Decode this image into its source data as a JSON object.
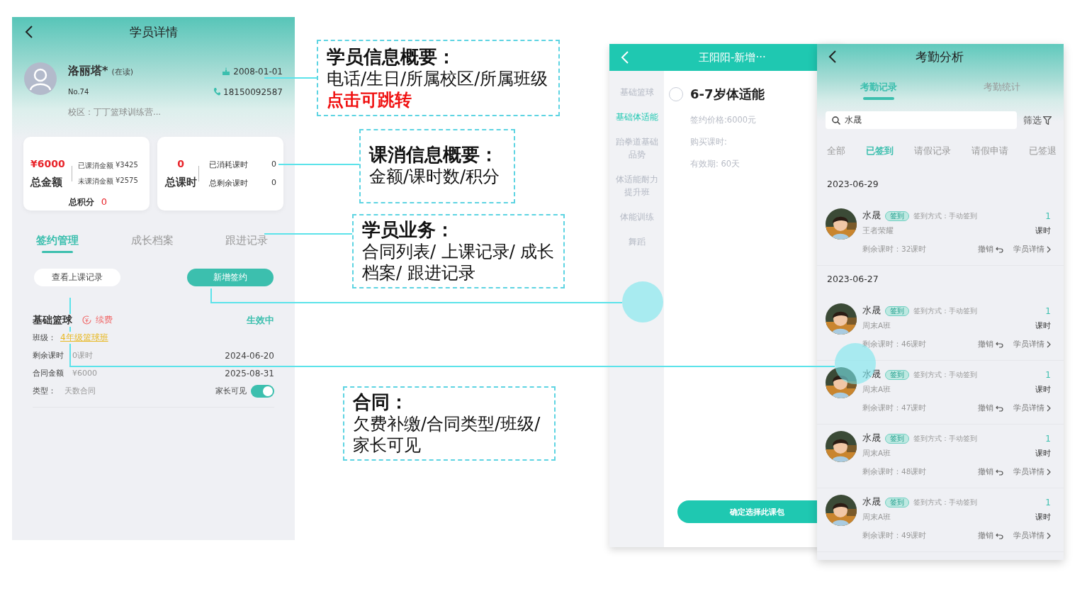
{
  "student": {
    "title": "学员详情",
    "name": "洛丽塔*",
    "status": "(在读)",
    "number": "No.74",
    "birthday": "2008-01-01",
    "phone": "18150092587",
    "campus": "校区：丁丁篮球训练营...",
    "amount_card": {
      "total": "¥6000",
      "total_label": "总金额",
      "consumed_label": "已课消金额",
      "consumed": "¥3425",
      "unconsumed_label": "未课消金额",
      "unconsumed": "¥2575",
      "points_label": "总积分",
      "points": "0"
    },
    "hours_card": {
      "total": "0",
      "total_label": "总课时",
      "used_label": "已消耗课时",
      "used": "0",
      "remaining_label": "总剩余课时",
      "remaining": "0"
    },
    "tabs": [
      {
        "label": "签约管理",
        "selected": true
      },
      {
        "label": "成长档案",
        "selected": false
      },
      {
        "label": "跟进记录",
        "selected": false
      }
    ],
    "buttons": [
      {
        "label": "查看上课记录",
        "kind": "secondary"
      },
      {
        "label": "新增签约",
        "kind": "primary"
      }
    ],
    "contract": {
      "course": "基础篮球",
      "renew": "续费",
      "state": "生效中",
      "class_label": "班级：",
      "class": "4年级篮球班",
      "remaining_label": "剩余课时",
      "remaining": "0课时",
      "start_date": "2024-06-20",
      "amount_label": "合同金额",
      "amount": "¥6000",
      "end_date": "2025-08-31",
      "type_label": "类型：",
      "type": "天数合同",
      "visible_label": "家长可见",
      "visible": true
    }
  },
  "annotations": [
    {
      "title": "学员信息概要：",
      "body": "电话/生日/所属校区/所属班级",
      "highlight": "点击可跳转"
    },
    {
      "title": "课消信息概要：",
      "body": "金额/课时数/积分"
    },
    {
      "title": "学员业务：",
      "body": "合同列表/ 上课记录/ 成长档案/ 跟进记录"
    },
    {
      "title": "合同：",
      "body": "欠费补缴/合同类型/班级/家长可见"
    }
  ],
  "package_picker": {
    "title": "王阳阳-新增···",
    "categories": [
      {
        "label": "基础篮球",
        "selected": false
      },
      {
        "label": "基础体适能",
        "selected": true
      },
      {
        "label": "跆拳道基础品势",
        "selected": false
      },
      {
        "label": "体适能耐力提升班",
        "selected": false
      },
      {
        "label": "体能训练",
        "selected": false
      },
      {
        "label": "舞蹈",
        "selected": false
      }
    ],
    "package": {
      "name": "6-7岁体适能",
      "checked": false,
      "price": "签约价格:6000元",
      "hours": "购买课时:",
      "validity": "有效期: 60天"
    },
    "confirm": "确定选择此课包"
  },
  "attendance": {
    "title": "考勤分析",
    "tabs": [
      {
        "label": "考勤记录",
        "selected": true
      },
      {
        "label": "考勤统计",
        "selected": false
      }
    ],
    "search": {
      "value": "水晟"
    },
    "filter": "筛选",
    "statuses": [
      {
        "label": "全部",
        "selected": false
      },
      {
        "label": "已签到",
        "selected": true
      },
      {
        "label": "请假记录",
        "selected": false
      },
      {
        "label": "请假申请",
        "selected": false
      },
      {
        "label": "已签退",
        "selected": false
      }
    ],
    "groups": [
      {
        "date": "2023-06-29",
        "records": [
          {
            "name": "水晟",
            "badge": "签到",
            "method": "签到方式：手动签到",
            "count": "1",
            "unit": "课时",
            "class": "王者荣耀",
            "remaining": "剩余课时：32课时",
            "undo": "撤销",
            "details": "学员详情"
          }
        ]
      },
      {
        "date": "2023-06-27",
        "records": [
          {
            "name": "水晟",
            "badge": "签到",
            "method": "签到方式：手动签到",
            "count": "1",
            "unit": "课时",
            "class": "周末A班",
            "remaining": "剩余课时：46课时",
            "undo": "撤销",
            "details": "学员详情"
          },
          {
            "name": "水晟",
            "badge": "签到",
            "method": "签到方式：手动签到",
            "count": "1",
            "unit": "课时",
            "class": "周末A班",
            "remaining": "剩余课时：47课时",
            "undo": "撤销",
            "details": "学员详情"
          },
          {
            "name": "水晟",
            "badge": "签到",
            "method": "签到方式：手动签到",
            "count": "1",
            "unit": "课时",
            "class": "周末A班",
            "remaining": "剩余课时：48课时",
            "undo": "撤销",
            "details": "学员详情"
          },
          {
            "name": "水晟",
            "badge": "签到",
            "method": "签到方式：手动签到",
            "count": "1",
            "unit": "课时",
            "class": "周末A班",
            "remaining": "剩余课时：49课时",
            "undo": "撤销",
            "details": "学员详情"
          }
        ]
      }
    ]
  }
}
